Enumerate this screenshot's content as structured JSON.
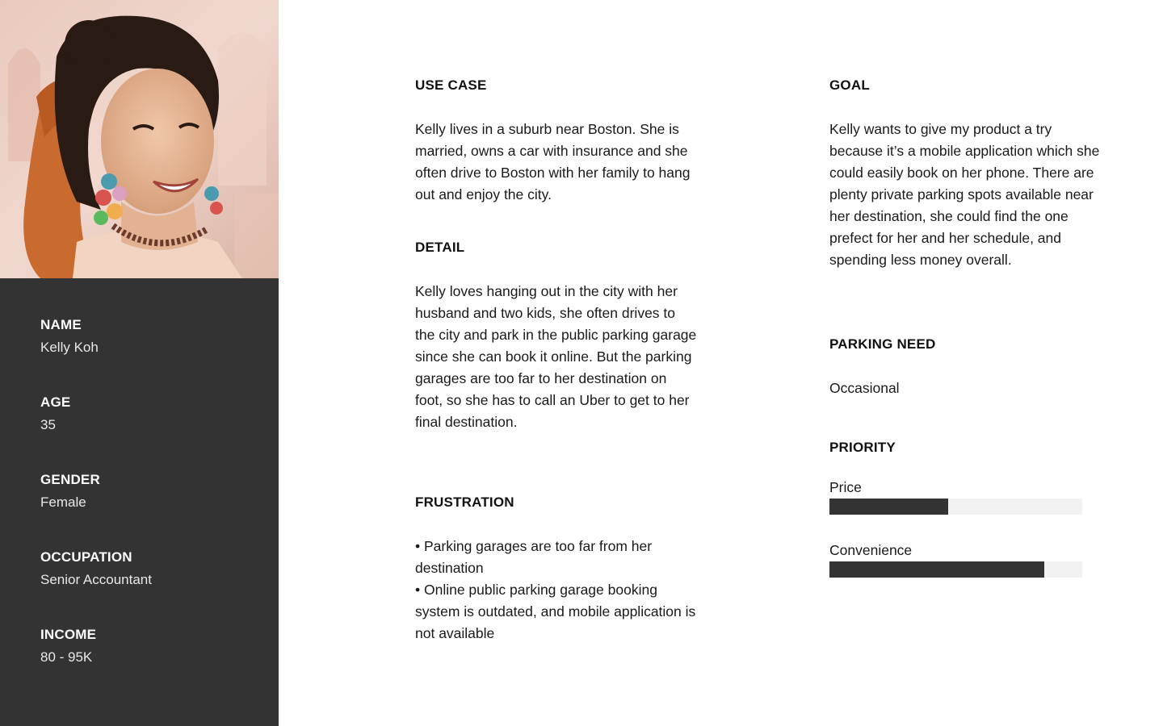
{
  "profile": {
    "photo": "portrait-photo",
    "name_label": "NAME",
    "name": "Kelly Koh",
    "age_label": "AGE",
    "age": "35",
    "gender_label": "GENDER",
    "gender": "Female",
    "occupation_label": "OCCUPATION",
    "occupation": "Senior Accountant",
    "income_label": "INCOME",
    "income": "80 - 95K"
  },
  "use_case": {
    "heading": "USE CASE",
    "text": "Kelly lives in a suburb near Boston. She is married, owns a car with insurance and she often drive to Boston with her family to hang out and enjoy the city."
  },
  "detail": {
    "heading": "DETAIL",
    "text": "Kelly loves hanging out in the city with her husband and two kids, she often drives to the city and park in the public parking garage since she can book it online. But the parking garages are too far to her destination on foot, so she has to call an Uber to get to her final destination."
  },
  "frustration": {
    "heading": "FRUSTRATION",
    "items": [
      "• Parking garages are too far from her destination",
      "• Online public parking garage booking system is outdated, and mobile application is not available"
    ]
  },
  "goal": {
    "heading": "GOAL",
    "text": "Kelly wants to give my product a try because it’s a mobile application which she could easily book on her phone. There are plenty private parking spots available near her destination, she could find the one prefect for her and her schedule, and spending less money overall."
  },
  "parking_need": {
    "heading": "PARKING NEED",
    "value": "Occasional"
  },
  "priority": {
    "heading": "PRIORITY",
    "items": [
      {
        "label": "Price",
        "level": 0.47
      },
      {
        "label": "Convenience",
        "level": 0.85
      }
    ]
  },
  "colors": {
    "sidebar_bg": "#333333",
    "bar_fill": "#333333",
    "bar_track": "#f2f2f2"
  }
}
